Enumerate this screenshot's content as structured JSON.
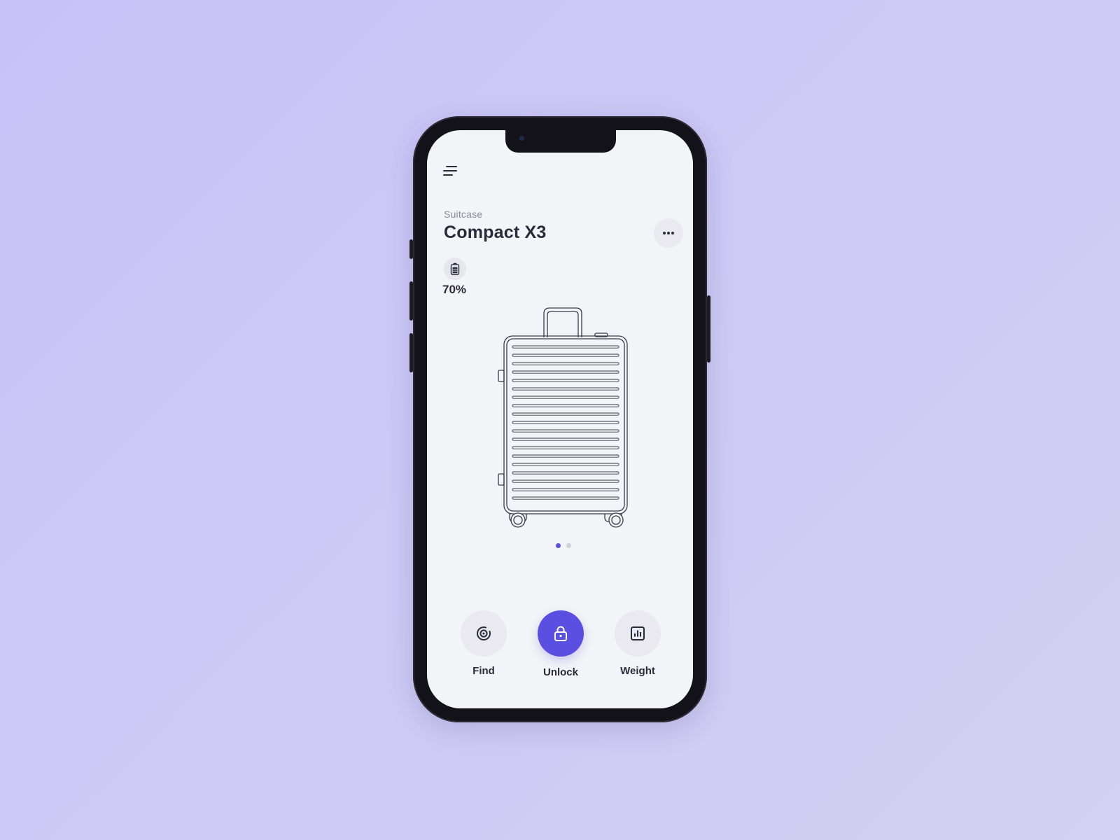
{
  "device": {
    "subtitle": "Suitcase",
    "title": "Compact X3",
    "battery": {
      "level_label": "70%",
      "level": 0.7
    }
  },
  "carousel": {
    "pages": 2,
    "active_index": 0
  },
  "actions": [
    {
      "label": "Find",
      "icon": "target-icon"
    },
    {
      "label": "Unlock",
      "icon": "lock-icon",
      "primary": true
    },
    {
      "label": "Weight",
      "icon": "bar-chart-icon"
    }
  ],
  "colors": {
    "accent": "#5a4fe0",
    "screen_bg": "#f3f4f7",
    "page_bg": "#cbc6f6",
    "text": "#2a2b3a",
    "muted": "#8a8a96"
  }
}
